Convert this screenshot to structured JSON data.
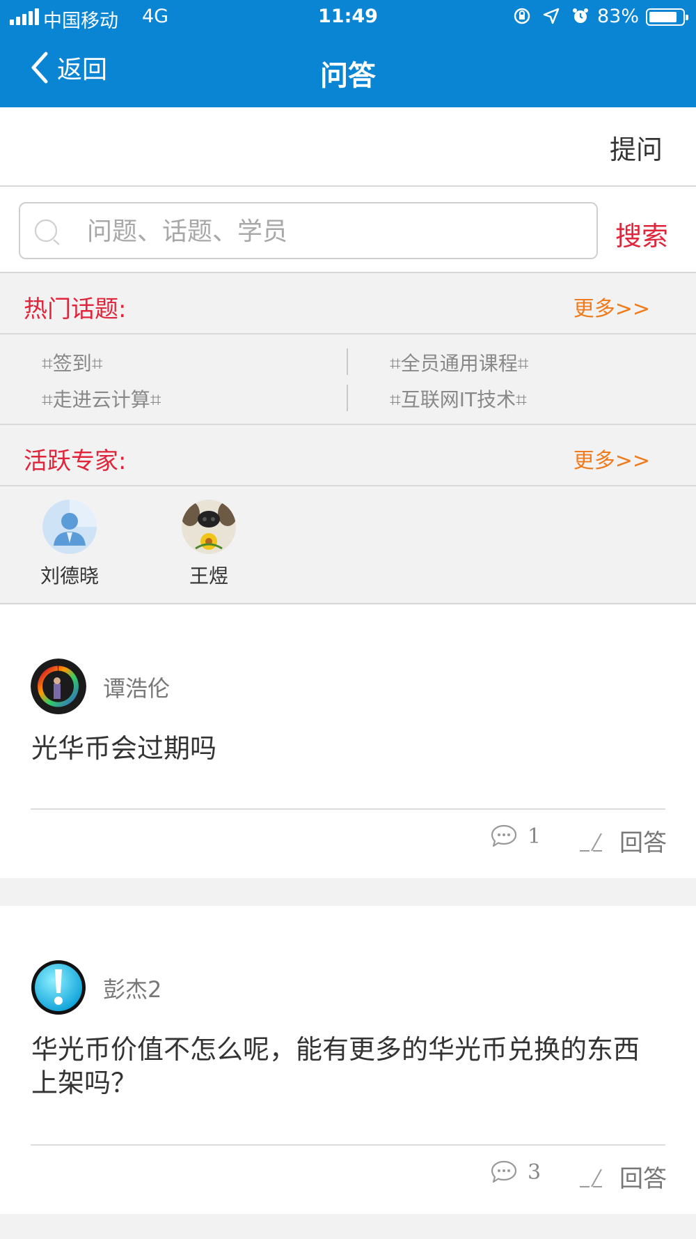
{
  "status_bar": {
    "carrier": "中国移动",
    "network": "4G",
    "time": "11:49",
    "battery": "83%",
    "icons": [
      "orientation-lock-icon",
      "location-arrow-icon",
      "alarm-icon"
    ]
  },
  "nav": {
    "back_label": "返回",
    "title": "问答"
  },
  "ask_label": "提问",
  "search": {
    "placeholder": "问题、话题、学员",
    "button": "搜索"
  },
  "hot_topics": {
    "title": "热门话题:",
    "more": "更多>>",
    "items": [
      "⌗签到⌗",
      "⌗全员通用课程⌗",
      "⌗走进云计算⌗",
      "⌗互联网IT技术⌗"
    ]
  },
  "experts": {
    "title": "活跃专家:",
    "more": "更多>>",
    "items": [
      {
        "name": "刘德晓",
        "avatar": "default-user-avatar"
      },
      {
        "name": "王煜",
        "avatar": "dog-photo-avatar"
      }
    ]
  },
  "questions": [
    {
      "user": "谭浩伦",
      "avatar": "photo-avatar",
      "text": "光华币会过期吗",
      "comments": "1",
      "answer_label": "回答"
    },
    {
      "user": "彭杰2",
      "avatar": "exclamation-avatar",
      "text": "华光币价值不怎么呢，能有更多的华光币兑换的东西上架吗？",
      "comments": "3",
      "answer_label": "回答"
    }
  ],
  "colors": {
    "nav_bg": "#0a85d3",
    "accent_red": "#e0243a",
    "more_orange": "#f07b1c"
  }
}
